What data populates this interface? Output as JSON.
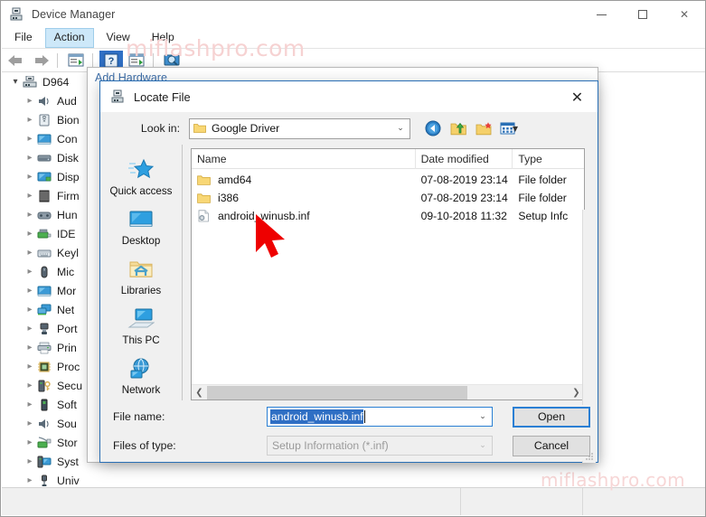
{
  "window": {
    "title": "Device Manager",
    "icon": "device-manager-icon",
    "controls": {
      "minimize": "—",
      "maximize": "□",
      "close": "✕"
    }
  },
  "menubar": {
    "items": [
      {
        "label": "File",
        "active": false
      },
      {
        "label": "Action",
        "active": true
      },
      {
        "label": "View",
        "active": false
      },
      {
        "label": "Help",
        "active": false
      }
    ]
  },
  "toolbar": {
    "buttons": [
      {
        "name": "back-arrow-icon"
      },
      {
        "name": "forward-arrow-icon"
      },
      {
        "name": "properties-icon"
      },
      {
        "name": "help-icon"
      },
      {
        "name": "update-driver-icon"
      },
      {
        "name": "scan-hardware-icon"
      }
    ]
  },
  "tree": {
    "root": {
      "label": "D964",
      "expanded": true
    },
    "items": [
      {
        "label": "Aud",
        "icon": "speaker-icon"
      },
      {
        "label": "Bion",
        "icon": "fingerprint-icon"
      },
      {
        "label": "Con",
        "icon": "monitor-icon"
      },
      {
        "label": "Disk",
        "icon": "disk-drive-icon"
      },
      {
        "label": "Disp",
        "icon": "display-adapter-icon"
      },
      {
        "label": "Firm",
        "icon": "firmware-icon"
      },
      {
        "label": "Hun",
        "icon": "hid-icon"
      },
      {
        "label": "IDE",
        "icon": "ide-controller-icon"
      },
      {
        "label": "Keyl",
        "icon": "keyboard-icon"
      },
      {
        "label": "Mic",
        "icon": "mouse-icon"
      },
      {
        "label": "Mor",
        "icon": "monitor-icon"
      },
      {
        "label": "Net",
        "icon": "network-adapter-icon"
      },
      {
        "label": "Port",
        "icon": "port-icon"
      },
      {
        "label": "Prin",
        "icon": "printer-icon"
      },
      {
        "label": "Proc",
        "icon": "processor-icon"
      },
      {
        "label": "Secu",
        "icon": "security-device-icon"
      },
      {
        "label": "Soft",
        "icon": "software-device-icon"
      },
      {
        "label": "Sou",
        "icon": "sound-controller-icon"
      },
      {
        "label": "Stor",
        "icon": "storage-controller-icon"
      },
      {
        "label": "Syst",
        "icon": "system-device-icon"
      },
      {
        "label": "Univ",
        "icon": "usb-controller-icon"
      }
    ]
  },
  "background_window": {
    "title": "Add Hardware"
  },
  "dialog": {
    "title": "Locate File",
    "icon": "device-manager-icon",
    "close_glyph": "✕",
    "lookin": {
      "label": "Look in:",
      "value": "Google Driver",
      "icon": "folder-icon",
      "arrow": "⌄"
    },
    "nav_buttons": [
      {
        "name": "back-navigation-icon"
      },
      {
        "name": "up-one-level-icon"
      },
      {
        "name": "new-folder-icon"
      },
      {
        "name": "views-icon"
      }
    ],
    "places": [
      {
        "label": "Quick access",
        "icon": "quick-access-star-icon"
      },
      {
        "label": "Desktop",
        "icon": "desktop-icon"
      },
      {
        "label": "Libraries",
        "icon": "libraries-folder-icon"
      },
      {
        "label": "This PC",
        "icon": "this-pc-icon"
      },
      {
        "label": "Network",
        "icon": "network-globe-icon"
      }
    ],
    "columns": [
      "Name",
      "Date modified",
      "Type"
    ],
    "sort_indicator": "˄",
    "files": [
      {
        "name": "amd64",
        "date": "07-08-2019 23:14",
        "type": "File folder",
        "icon": "folder-icon"
      },
      {
        "name": "i386",
        "date": "07-08-2019 23:14",
        "type": "File folder",
        "icon": "folder-icon"
      },
      {
        "name": "android_winusb.inf",
        "date": "09-10-2018 11:32",
        "type": "Setup Infc",
        "icon": "inf-file-icon"
      }
    ],
    "scroll": {
      "left_arrow": "❮",
      "right_arrow": "❯"
    },
    "filename": {
      "label": "File name:",
      "value": "android_winusb.inf",
      "selected": true,
      "arrow": "⌄"
    },
    "filetype": {
      "label": "Files of type:",
      "value": "Setup Information (*.inf)",
      "arrow": "⌄"
    },
    "buttons": {
      "open": "Open",
      "cancel": "Cancel"
    }
  },
  "watermark": {
    "text": "miflashpro.com"
  },
  "colors": {
    "accent_blue": "#2a7fd4",
    "selection_blue": "#2f6fc4",
    "menu_highlight": "#cde8f9",
    "cursor_red": "#ee0000",
    "watermark_pink": "#f6d2d2"
  }
}
